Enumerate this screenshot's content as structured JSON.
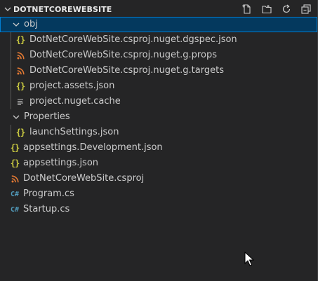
{
  "explorer": {
    "section_title": "DOTNETCOREWEBSITE",
    "toolbar": {
      "new_file_icon": "new-file-icon",
      "new_folder_icon": "new-folder-icon",
      "refresh_icon": "refresh-icon",
      "collapse_all_icon": "collapse-all-icon"
    },
    "items": [
      {
        "label": "obj",
        "kind": "folder",
        "expanded": true,
        "selected": true,
        "icon": "chevron-down-icon"
      },
      {
        "label": "DotNetCoreWebSite.csproj.nuget.dgspec.json",
        "kind": "json",
        "icon": "json-braces-icon"
      },
      {
        "label": "DotNetCoreWebSite.csproj.nuget.g.props",
        "kind": "xml",
        "icon": "rss-icon"
      },
      {
        "label": "DotNetCoreWebSite.csproj.nuget.g.targets",
        "kind": "xml",
        "icon": "rss-icon"
      },
      {
        "label": "project.assets.json",
        "kind": "json",
        "icon": "json-braces-icon"
      },
      {
        "label": "project.nuget.cache",
        "kind": "text",
        "icon": "lines-icon"
      },
      {
        "label": "Properties",
        "kind": "folder",
        "expanded": true,
        "icon": "chevron-down-icon"
      },
      {
        "label": "launchSettings.json",
        "kind": "json",
        "icon": "json-braces-icon"
      },
      {
        "label": "appsettings.Development.json",
        "kind": "json",
        "icon": "json-braces-icon"
      },
      {
        "label": "appsettings.json",
        "kind": "json",
        "icon": "json-braces-icon"
      },
      {
        "label": "DotNetCoreWebSite.csproj",
        "kind": "xml",
        "icon": "rss-icon"
      },
      {
        "label": "Program.cs",
        "kind": "csharp",
        "icon": "csharp-icon"
      },
      {
        "label": "Startup.cs",
        "kind": "csharp",
        "icon": "csharp-icon"
      }
    ]
  },
  "colors": {
    "background": "#252526",
    "selection": "#04395e",
    "selection_border": "#007fd4",
    "json": "#cbcb41",
    "rss": "#e37933",
    "csharp": "#519aba",
    "text": "#cccccc"
  }
}
